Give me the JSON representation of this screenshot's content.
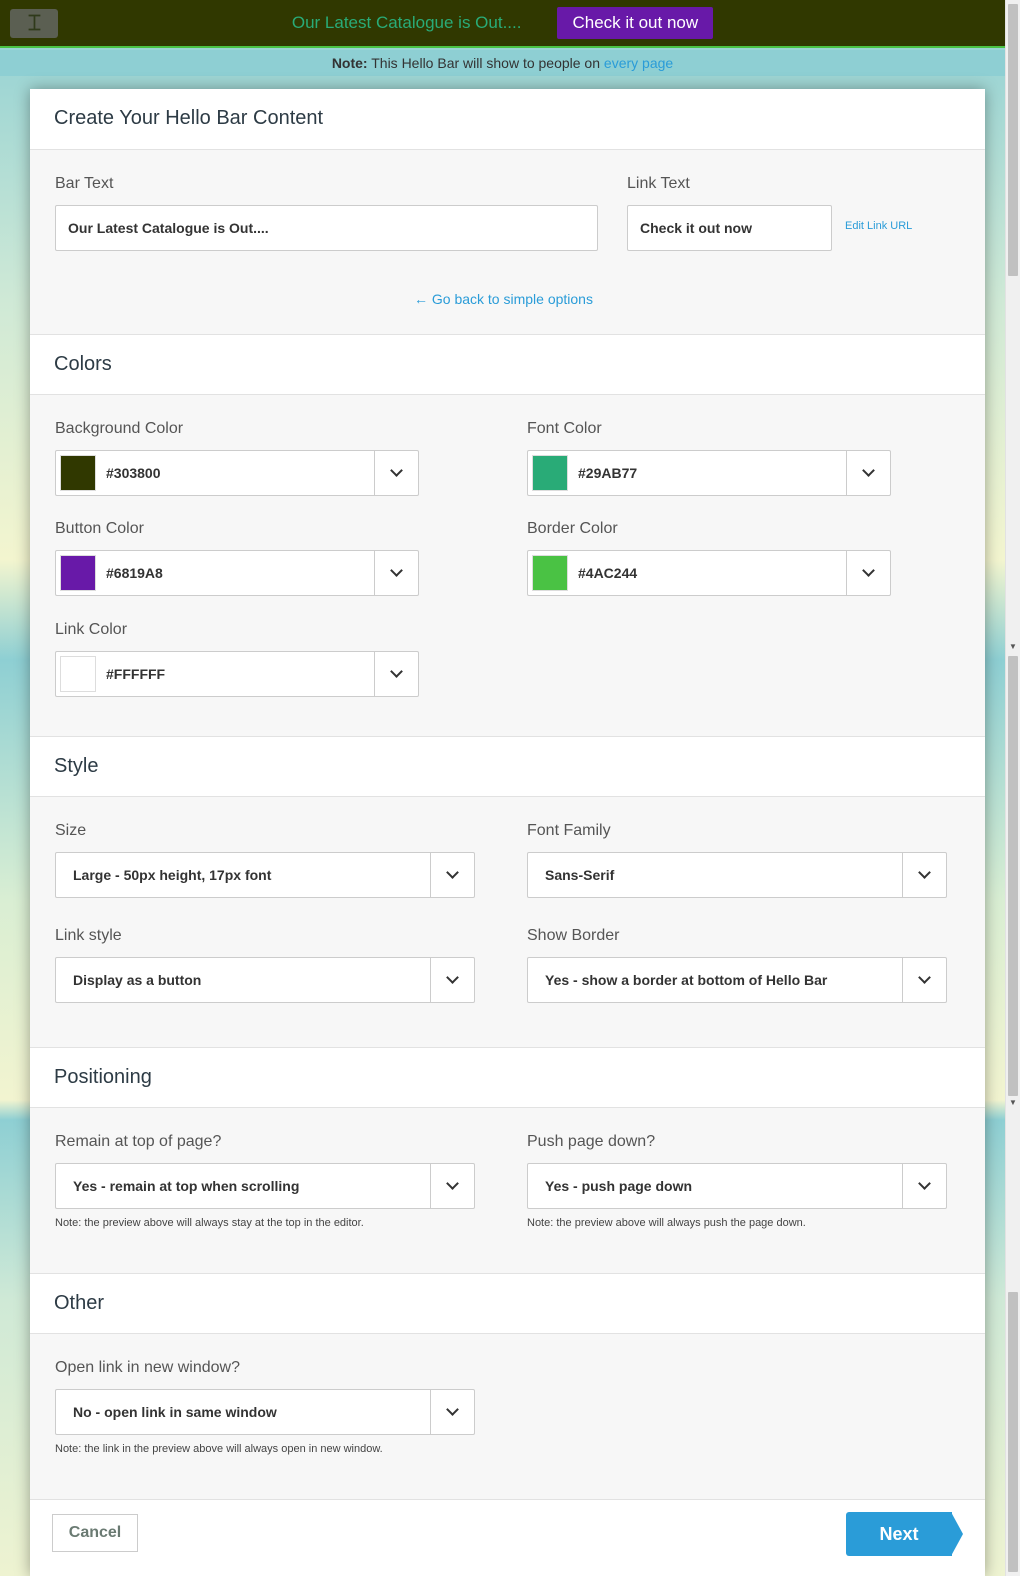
{
  "hellobar": {
    "text": "Our Latest Catalogue is Out....",
    "button": "Check it out now",
    "colors": {
      "background": "#303800",
      "font": "#29AB77",
      "button": "#6819A8",
      "border": "#4AC244",
      "link": "#FFFFFF"
    }
  },
  "note": {
    "bold": "Note:",
    "text": " This Hello Bar will show to people on ",
    "link": "every page"
  },
  "modal": {
    "title": "Create Your Hello Bar Content",
    "content": {
      "bar_text_label": "Bar Text",
      "bar_text_value": "Our Latest Catalogue is Out....",
      "link_text_label": "Link Text",
      "link_text_value": "Check it out now",
      "edit_link": "Edit Link URL",
      "back_link": "← Go back to simple options"
    },
    "colors": {
      "title": "Colors",
      "background": {
        "label": "Background Color",
        "value": "#303800",
        "swatch": "#303800"
      },
      "font": {
        "label": "Font Color",
        "value": "#29AB77",
        "swatch": "#29AB77"
      },
      "button": {
        "label": "Button Color",
        "value": "#6819A8",
        "swatch": "#6819A8"
      },
      "border": {
        "label": "Border Color",
        "value": "#4AC244",
        "swatch": "#4AC244"
      },
      "link": {
        "label": "Link Color",
        "value": "#FFFFFF",
        "swatch": "#FFFFFF"
      }
    },
    "style": {
      "title": "Style",
      "size": {
        "label": "Size",
        "value": "Large - 50px height, 17px font"
      },
      "font_family": {
        "label": "Font Family",
        "value": "Sans-Serif"
      },
      "link_style": {
        "label": "Link style",
        "value": "Display as a button"
      },
      "show_border": {
        "label": "Show Border",
        "value": "Yes - show a border at bottom of Hello Bar"
      }
    },
    "positioning": {
      "title": "Positioning",
      "remain": {
        "label": "Remain at top of page?",
        "value": "Yes - remain at top when scrolling",
        "note": "Note: the preview above will always stay at the top in the editor."
      },
      "push": {
        "label": "Push page down?",
        "value": "Yes - push page down",
        "note": "Note: the preview above will always push the page down."
      }
    },
    "other": {
      "title": "Other",
      "open_link": {
        "label": "Open link in new window?",
        "value": "No - open link in same window",
        "note": "Note: the link in the preview above will always open in new window."
      }
    },
    "footer": {
      "cancel": "Cancel",
      "next": "Next"
    }
  }
}
